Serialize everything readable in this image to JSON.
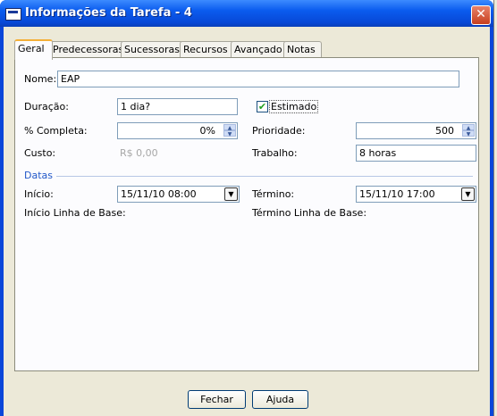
{
  "window": {
    "title": "Informações da Tarefa - 4",
    "close": "✕"
  },
  "tabs": [
    "Geral",
    "Predecessoras",
    "Sucessoras",
    "Recursos",
    "Avançado",
    "Notas"
  ],
  "form": {
    "nome_label": "Nome:",
    "nome_value": "EAP",
    "duracao_label": "Duração:",
    "duracao_value": "1 dia?",
    "estimado_label": "Estimado",
    "estimado_checked": true,
    "completa_label": "% Completa:",
    "completa_value": "0%",
    "prioridade_label": "Prioridade:",
    "prioridade_value": "500",
    "custo_label": "Custo:",
    "custo_value": "R$ 0,00",
    "trabalho_label": "Trabalho:",
    "trabalho_value": "8 horas"
  },
  "datas": {
    "section_label": "Datas",
    "inicio_label": "Início:",
    "inicio_value": "15/11/10 08:00",
    "termino_label": "Término:",
    "termino_value": "15/11/10 17:00",
    "inicio_base_label": "Início Linha de Base:",
    "termino_base_label": "Término Linha de Base:"
  },
  "buttons": {
    "fechar": "Fechar",
    "ajuda": "Ajuda"
  },
  "icons": {
    "check": "✔",
    "spin_up": "▲",
    "spin_down": "▼",
    "dropdown": "▼"
  }
}
